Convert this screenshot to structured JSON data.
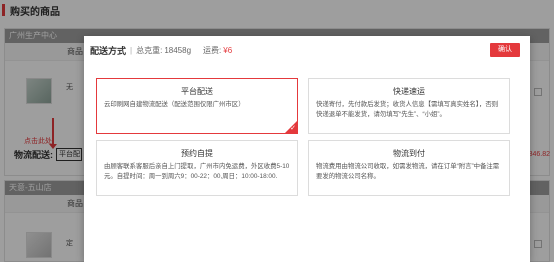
{
  "page": {
    "title": "购买的商品"
  },
  "stores": [
    {
      "name": "广州生产中心",
      "product_header": "商品",
      "product_text": "无"
    },
    {
      "name": "天意-五山店",
      "product_header": "商品",
      "product_text": "定"
    }
  ],
  "delivery": {
    "label": "物流配送:",
    "current": "平台配",
    "click_hint": "点击此处"
  },
  "price_fragment": "846.82",
  "modal": {
    "title": "配送方式",
    "weight_label": "总克重:",
    "weight_value": "18458g",
    "fee_label": "运费:",
    "fee_value": "¥6",
    "confirm_label": "确认",
    "options": [
      {
        "title": "平台配送",
        "desc": "云印刷网自建物流配送（配送范围仅限广州市区）",
        "selected": true
      },
      {
        "title": "快递速运",
        "desc": "快递寄付，先付款后发货；收货人信息【需填写真实姓名】，否则快递退单不能发货，请勿填写“先生”、“小姐”。",
        "selected": false
      },
      {
        "title": "预约自提",
        "desc": "由顾客联系客服后亲自上门提取，广州市内免运费，外区收费5-10元。自提时间：周一到周六9：00-22：00,周日：10:00-18:00.",
        "selected": false
      },
      {
        "title": "物流到付",
        "desc": "物流费用由物流公司收取，如需发物流，请在订单“附言”中备注需要发的物流公司名称。",
        "selected": false
      }
    ]
  },
  "colors": {
    "accent": "#e4393c",
    "store_header": "#9e9e9e"
  }
}
